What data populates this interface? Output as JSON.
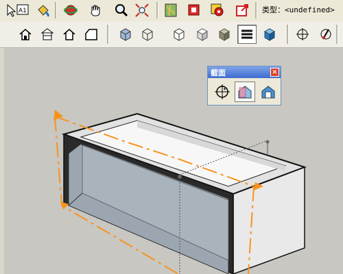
{
  "toolbar": {
    "row1_icons": [
      "text-icon",
      "paint-bucket-icon",
      "orbit-icon",
      "pan-hand-icon",
      "zoom-icon",
      "zoom-extents-icon",
      "map-icon",
      "photo-textures-icon",
      "geo-location-icon",
      "share-model-icon"
    ],
    "row2_icons": [
      "iso-view-icon",
      "top-view-icon",
      "front-view-icon",
      "right-view-icon",
      "back-view-icon",
      "xray-icon",
      "wireframe-icon",
      "hidden-line-icon",
      "shaded-icon",
      "shaded-textures-icon",
      "monochrome-icon",
      "section-plane-icon",
      "display-section-cuts-icon"
    ],
    "type_label": "类型：<undefined>"
  },
  "section_panel": {
    "title": "截面",
    "close": "×",
    "buttons": [
      "section-plane-tool-icon",
      "display-section-planes-icon",
      "display-section-cuts-icon"
    ]
  },
  "colors": {
    "section_plane": "#f7931e",
    "box_face": "#dcdcdc",
    "inner_face": "#9aa6b2",
    "panel_title": "#3d6bd0"
  }
}
